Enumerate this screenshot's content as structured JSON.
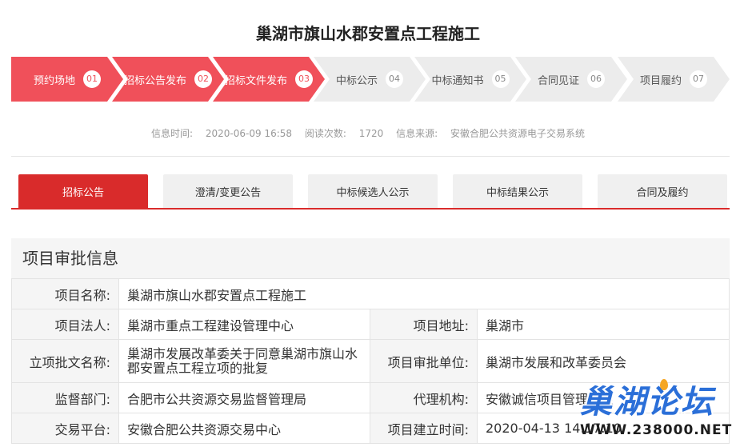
{
  "page": {
    "title": "巢湖市旗山水郡安置点工程施工"
  },
  "steps": [
    {
      "label": "预约场地",
      "num": "01",
      "state": "active"
    },
    {
      "label": "招标公告发布",
      "num": "02",
      "state": "active"
    },
    {
      "label": "招标文件发布",
      "num": "03",
      "state": "active"
    },
    {
      "label": "中标公示",
      "num": "04",
      "state": "inactive"
    },
    {
      "label": "中标通知书",
      "num": "05",
      "state": "inactive"
    },
    {
      "label": "合同见证",
      "num": "06",
      "state": "inactive"
    },
    {
      "label": "项目履约",
      "num": "07",
      "state": "inactive"
    }
  ],
  "info": {
    "time_label": "信息时间:",
    "time_value": "2020-06-09 16:58",
    "reads_label": "阅读次数:",
    "reads_value": "1720",
    "source_label": "信息来源:",
    "source_value": "安徽合肥公共资源电子交易系统"
  },
  "tabs": [
    "招标公告",
    "澄清/变更公告",
    "中标候选人公示",
    "中标结果公示",
    "合同及履约"
  ],
  "section": {
    "title": "项目审批信息"
  },
  "approval": {
    "name_label": "项目名称:",
    "name_value": "巢湖市旗山水郡安置点工程施工",
    "legal_label": "项目法人:",
    "legal_value": "巢湖市重点工程建设管理中心",
    "addr_label": "项目地址:",
    "addr_value": "巢湖市",
    "doc_label": "立项批文名称:",
    "doc_value": "巢湖市发展改革委关于同意巢湖市旗山水郡安置点工程立项的批复",
    "unit_label": "项目审批单位:",
    "unit_value": "巢湖市发展和改革委员会",
    "supervise_label": "监督部门:",
    "supervise_value": "合肥市公共资源交易监督管理局",
    "agent_label": "代理机构:",
    "agent_value": "安徽诚信项目管理有限",
    "platform_label": "交易平台:",
    "platform_value": "安徽合肥公共资源交易中心",
    "created_label": "项目建立时间:",
    "created_value": "2020-04-13 14:17:10"
  },
  "watermark": {
    "text": "巢湖论坛",
    "url": "WWW.238000.NET"
  },
  "colors": {
    "accent": "#d92b2b",
    "step_active": "#f0505a",
    "step_inactive": "#ececec",
    "watermark": "#2b6fd8"
  }
}
